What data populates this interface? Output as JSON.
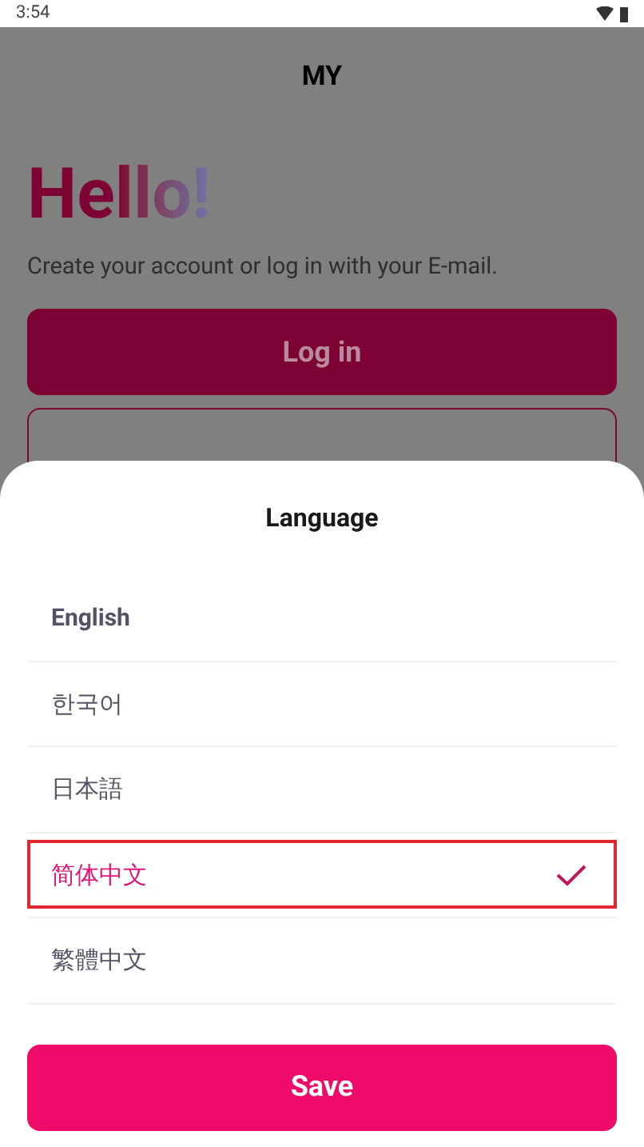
{
  "status_bar": {
    "time": "3:54"
  },
  "header": {
    "title": "MY"
  },
  "greeting": {
    "title": "Hello!",
    "subtitle": "Create your account or log in with your E-mail."
  },
  "buttons": [
    {
      "label": "Log in",
      "kind": "filled"
    },
    {
      "kind": "outline"
    }
  ],
  "language_sheet": {
    "title": "Language",
    "items": [
      {
        "label": "English",
        "current": true,
        "selected": false
      },
      {
        "label": "한국어",
        "current": false,
        "selected": false
      },
      {
        "label": "日本語",
        "current": false,
        "selected": false
      },
      {
        "label": "简体中文",
        "current": false,
        "selected": true
      },
      {
        "label": "繁體中文",
        "current": false,
        "selected": false
      }
    ],
    "save_button": "Save"
  }
}
